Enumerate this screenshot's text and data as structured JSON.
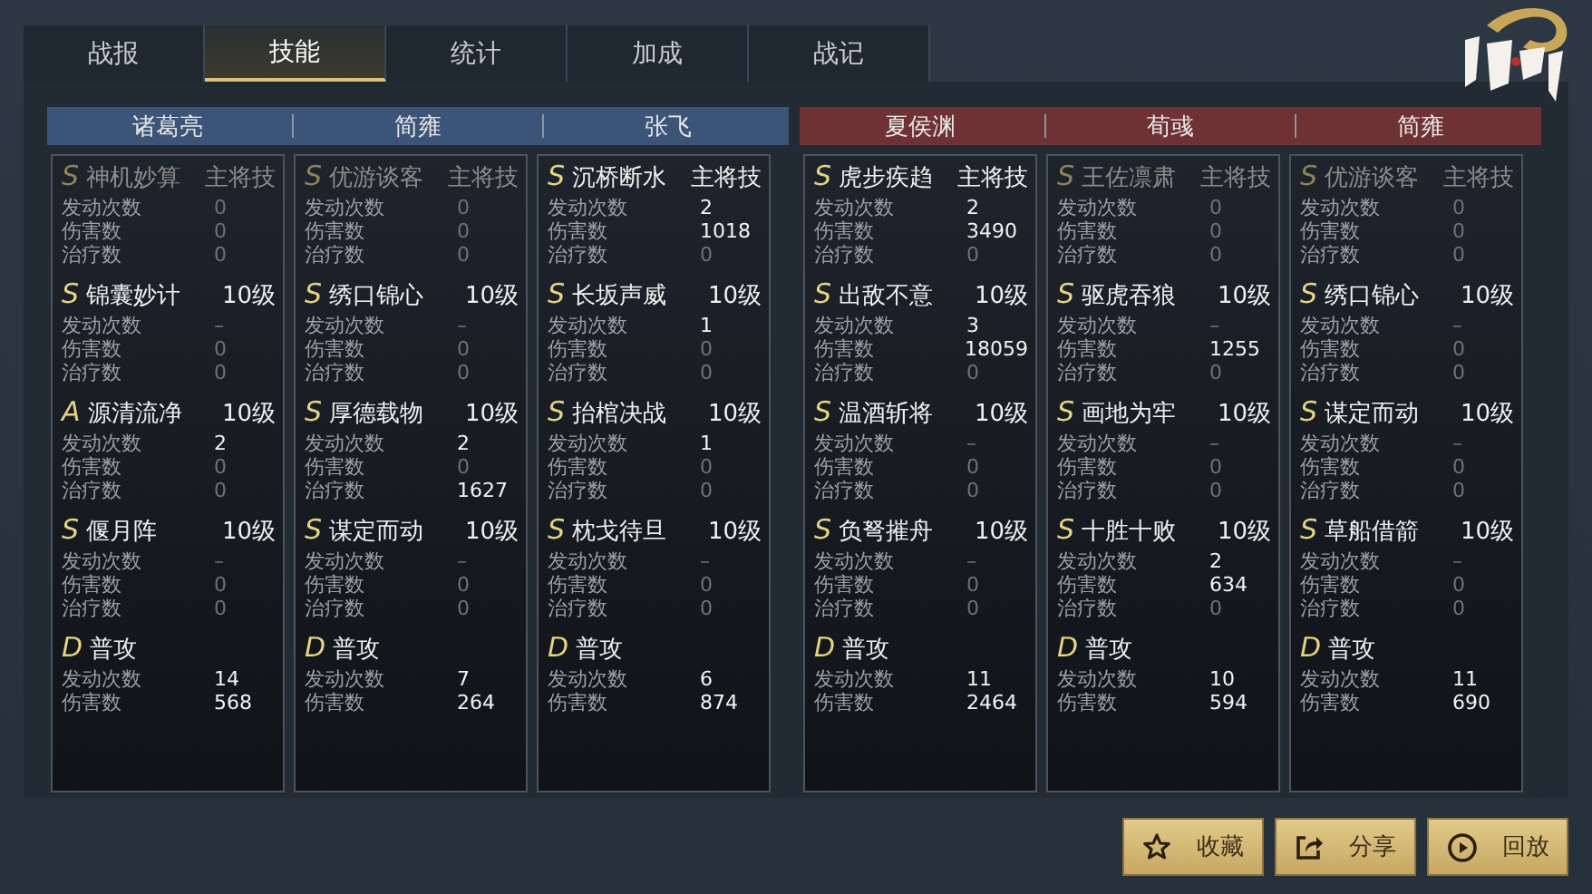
{
  "tabs": [
    {
      "label": "战报",
      "selected": false
    },
    {
      "label": "技能",
      "selected": true
    },
    {
      "label": "统计",
      "selected": false
    },
    {
      "label": "加成",
      "selected": false
    },
    {
      "label": "战记",
      "selected": false
    }
  ],
  "teams": [
    {
      "color": "#3b5478",
      "generals": [
        {
          "name": "诸葛亮",
          "skills": [
            {
              "grade": "S",
              "name": "神机妙算",
              "tag": "主将技",
              "active": false,
              "stats": [
                {
                  "label": "发动次数",
                  "value": "0",
                  "muted": true
                },
                {
                  "label": "伤害数",
                  "value": "0",
                  "muted": true
                },
                {
                  "label": "治疗数",
                  "value": "0",
                  "muted": true
                }
              ]
            },
            {
              "grade": "S",
              "name": "锦囊妙计",
              "tag": "10级",
              "active": true,
              "stats": [
                {
                  "label": "发动次数",
                  "value": "–",
                  "muted": true
                },
                {
                  "label": "伤害数",
                  "value": "0",
                  "muted": true
                },
                {
                  "label": "治疗数",
                  "value": "0",
                  "muted": true
                }
              ]
            },
            {
              "grade": "A",
              "name": "源清流净",
              "tag": "10级",
              "active": true,
              "stats": [
                {
                  "label": "发动次数",
                  "value": "2",
                  "muted": false
                },
                {
                  "label": "伤害数",
                  "value": "0",
                  "muted": true
                },
                {
                  "label": "治疗数",
                  "value": "0",
                  "muted": true
                }
              ]
            },
            {
              "grade": "S",
              "name": "偃月阵",
              "tag": "10级",
              "active": true,
              "stats": [
                {
                  "label": "发动次数",
                  "value": "–",
                  "muted": true
                },
                {
                  "label": "伤害数",
                  "value": "0",
                  "muted": true
                },
                {
                  "label": "治疗数",
                  "value": "0",
                  "muted": true
                }
              ]
            },
            {
              "grade": "D",
              "name": "普攻",
              "active": true,
              "stats": [
                {
                  "label": "发动次数",
                  "value": "14",
                  "muted": false
                },
                {
                  "label": "伤害数",
                  "value": "568",
                  "muted": false
                }
              ]
            }
          ]
        },
        {
          "name": "简雍",
          "skills": [
            {
              "grade": "S",
              "name": "优游谈客",
              "tag": "主将技",
              "active": false,
              "stats": [
                {
                  "label": "发动次数",
                  "value": "0",
                  "muted": true
                },
                {
                  "label": "伤害数",
                  "value": "0",
                  "muted": true
                },
                {
                  "label": "治疗数",
                  "value": "0",
                  "muted": true
                }
              ]
            },
            {
              "grade": "S",
              "name": "绣口锦心",
              "tag": "10级",
              "active": true,
              "stats": [
                {
                  "label": "发动次数",
                  "value": "–",
                  "muted": true
                },
                {
                  "label": "伤害数",
                  "value": "0",
                  "muted": true
                },
                {
                  "label": "治疗数",
                  "value": "0",
                  "muted": true
                }
              ]
            },
            {
              "grade": "S",
              "name": "厚德载物",
              "tag": "10级",
              "active": true,
              "stats": [
                {
                  "label": "发动次数",
                  "value": "2",
                  "muted": false
                },
                {
                  "label": "伤害数",
                  "value": "0",
                  "muted": true
                },
                {
                  "label": "治疗数",
                  "value": "1627",
                  "muted": false
                }
              ]
            },
            {
              "grade": "S",
              "name": "谋定而动",
              "tag": "10级",
              "active": true,
              "stats": [
                {
                  "label": "发动次数",
                  "value": "–",
                  "muted": true
                },
                {
                  "label": "伤害数",
                  "value": "0",
                  "muted": true
                },
                {
                  "label": "治疗数",
                  "value": "0",
                  "muted": true
                }
              ]
            },
            {
              "grade": "D",
              "name": "普攻",
              "active": true,
              "stats": [
                {
                  "label": "发动次数",
                  "value": "7",
                  "muted": false
                },
                {
                  "label": "伤害数",
                  "value": "264",
                  "muted": false
                }
              ]
            }
          ]
        },
        {
          "name": "张飞",
          "skills": [
            {
              "grade": "S",
              "name": "沉桥断水",
              "tag": "主将技",
              "active": true,
              "stats": [
                {
                  "label": "发动次数",
                  "value": "2",
                  "muted": false
                },
                {
                  "label": "伤害数",
                  "value": "1018",
                  "muted": false
                },
                {
                  "label": "治疗数",
                  "value": "0",
                  "muted": true
                }
              ]
            },
            {
              "grade": "S",
              "name": "长坂声威",
              "tag": "10级",
              "active": true,
              "stats": [
                {
                  "label": "发动次数",
                  "value": "1",
                  "muted": false
                },
                {
                  "label": "伤害数",
                  "value": "0",
                  "muted": true
                },
                {
                  "label": "治疗数",
                  "value": "0",
                  "muted": true
                }
              ]
            },
            {
              "grade": "S",
              "name": "抬棺决战",
              "tag": "10级",
              "active": true,
              "stats": [
                {
                  "label": "发动次数",
                  "value": "1",
                  "muted": false
                },
                {
                  "label": "伤害数",
                  "value": "0",
                  "muted": true
                },
                {
                  "label": "治疗数",
                  "value": "0",
                  "muted": true
                }
              ]
            },
            {
              "grade": "S",
              "name": "枕戈待旦",
              "tag": "10级",
              "active": true,
              "stats": [
                {
                  "label": "发动次数",
                  "value": "–",
                  "muted": true
                },
                {
                  "label": "伤害数",
                  "value": "0",
                  "muted": true
                },
                {
                  "label": "治疗数",
                  "value": "0",
                  "muted": true
                }
              ]
            },
            {
              "grade": "D",
              "name": "普攻",
              "active": true,
              "stats": [
                {
                  "label": "发动次数",
                  "value": "6",
                  "muted": false
                },
                {
                  "label": "伤害数",
                  "value": "874",
                  "muted": false
                }
              ]
            }
          ]
        }
      ]
    },
    {
      "color": "#6e3134",
      "generals": [
        {
          "name": "夏侯渊",
          "skills": [
            {
              "grade": "S",
              "name": "虎步疾趋",
              "tag": "主将技",
              "active": true,
              "stats": [
                {
                  "label": "发动次数",
                  "value": "2",
                  "muted": false
                },
                {
                  "label": "伤害数",
                  "value": "3490",
                  "muted": false
                },
                {
                  "label": "治疗数",
                  "value": "0",
                  "muted": true
                }
              ]
            },
            {
              "grade": "S",
              "name": "出敌不意",
              "tag": "10级",
              "active": true,
              "stats": [
                {
                  "label": "发动次数",
                  "value": "3",
                  "muted": false
                },
                {
                  "label": "伤害数",
                  "value": "18059",
                  "muted": false
                },
                {
                  "label": "治疗数",
                  "value": "0",
                  "muted": true
                }
              ]
            },
            {
              "grade": "S",
              "name": "温酒斩将",
              "tag": "10级",
              "active": true,
              "stats": [
                {
                  "label": "发动次数",
                  "value": "–",
                  "muted": true
                },
                {
                  "label": "伤害数",
                  "value": "0",
                  "muted": true
                },
                {
                  "label": "治疗数",
                  "value": "0",
                  "muted": true
                }
              ]
            },
            {
              "grade": "S",
              "name": "负弩摧舟",
              "tag": "10级",
              "active": true,
              "stats": [
                {
                  "label": "发动次数",
                  "value": "–",
                  "muted": true
                },
                {
                  "label": "伤害数",
                  "value": "0",
                  "muted": true
                },
                {
                  "label": "治疗数",
                  "value": "0",
                  "muted": true
                }
              ]
            },
            {
              "grade": "D",
              "name": "普攻",
              "active": true,
              "stats": [
                {
                  "label": "发动次数",
                  "value": "11",
                  "muted": false
                },
                {
                  "label": "伤害数",
                  "value": "2464",
                  "muted": false
                }
              ]
            }
          ]
        },
        {
          "name": "荀彧",
          "skills": [
            {
              "grade": "S",
              "name": "王佐凛肃",
              "tag": "主将技",
              "active": false,
              "stats": [
                {
                  "label": "发动次数",
                  "value": "0",
                  "muted": true
                },
                {
                  "label": "伤害数",
                  "value": "0",
                  "muted": true
                },
                {
                  "label": "治疗数",
                  "value": "0",
                  "muted": true
                }
              ]
            },
            {
              "grade": "S",
              "name": "驱虎吞狼",
              "tag": "10级",
              "active": true,
              "stats": [
                {
                  "label": "发动次数",
                  "value": "–",
                  "muted": true
                },
                {
                  "label": "伤害数",
                  "value": "1255",
                  "muted": false
                },
                {
                  "label": "治疗数",
                  "value": "0",
                  "muted": true
                }
              ]
            },
            {
              "grade": "S",
              "name": "画地为牢",
              "tag": "10级",
              "active": true,
              "stats": [
                {
                  "label": "发动次数",
                  "value": "–",
                  "muted": true
                },
                {
                  "label": "伤害数",
                  "value": "0",
                  "muted": true
                },
                {
                  "label": "治疗数",
                  "value": "0",
                  "muted": true
                }
              ]
            },
            {
              "grade": "S",
              "name": "十胜十败",
              "tag": "10级",
              "active": true,
              "stats": [
                {
                  "label": "发动次数",
                  "value": "2",
                  "muted": false
                },
                {
                  "label": "伤害数",
                  "value": "634",
                  "muted": false
                },
                {
                  "label": "治疗数",
                  "value": "0",
                  "muted": true
                }
              ]
            },
            {
              "grade": "D",
              "name": "普攻",
              "active": true,
              "stats": [
                {
                  "label": "发动次数",
                  "value": "10",
                  "muted": false
                },
                {
                  "label": "伤害数",
                  "value": "594",
                  "muted": false
                }
              ]
            }
          ]
        },
        {
          "name": "简雍",
          "skills": [
            {
              "grade": "S",
              "name": "优游谈客",
              "tag": "主将技",
              "active": false,
              "stats": [
                {
                  "label": "发动次数",
                  "value": "0",
                  "muted": true
                },
                {
                  "label": "伤害数",
                  "value": "0",
                  "muted": true
                },
                {
                  "label": "治疗数",
                  "value": "0",
                  "muted": true
                }
              ]
            },
            {
              "grade": "S",
              "name": "绣口锦心",
              "tag": "10级",
              "active": true,
              "stats": [
                {
                  "label": "发动次数",
                  "value": "–",
                  "muted": true
                },
                {
                  "label": "伤害数",
                  "value": "0",
                  "muted": true
                },
                {
                  "label": "治疗数",
                  "value": "0",
                  "muted": true
                }
              ]
            },
            {
              "grade": "S",
              "name": "谋定而动",
              "tag": "10级",
              "active": true,
              "stats": [
                {
                  "label": "发动次数",
                  "value": "–",
                  "muted": true
                },
                {
                  "label": "伤害数",
                  "value": "0",
                  "muted": true
                },
                {
                  "label": "治疗数",
                  "value": "0",
                  "muted": true
                }
              ]
            },
            {
              "grade": "S",
              "name": "草船借箭",
              "tag": "10级",
              "active": true,
              "stats": [
                {
                  "label": "发动次数",
                  "value": "–",
                  "muted": true
                },
                {
                  "label": "伤害数",
                  "value": "0",
                  "muted": true
                },
                {
                  "label": "治疗数",
                  "value": "0",
                  "muted": true
                }
              ]
            },
            {
              "grade": "D",
              "name": "普攻",
              "active": true,
              "stats": [
                {
                  "label": "发动次数",
                  "value": "11",
                  "muted": false
                },
                {
                  "label": "伤害数",
                  "value": "690",
                  "muted": false
                }
              ]
            }
          ]
        }
      ]
    }
  ],
  "buttons": [
    {
      "kind": "star",
      "label": "收藏"
    },
    {
      "kind": "share",
      "label": "分享"
    },
    {
      "kind": "play",
      "label": "回放"
    }
  ]
}
